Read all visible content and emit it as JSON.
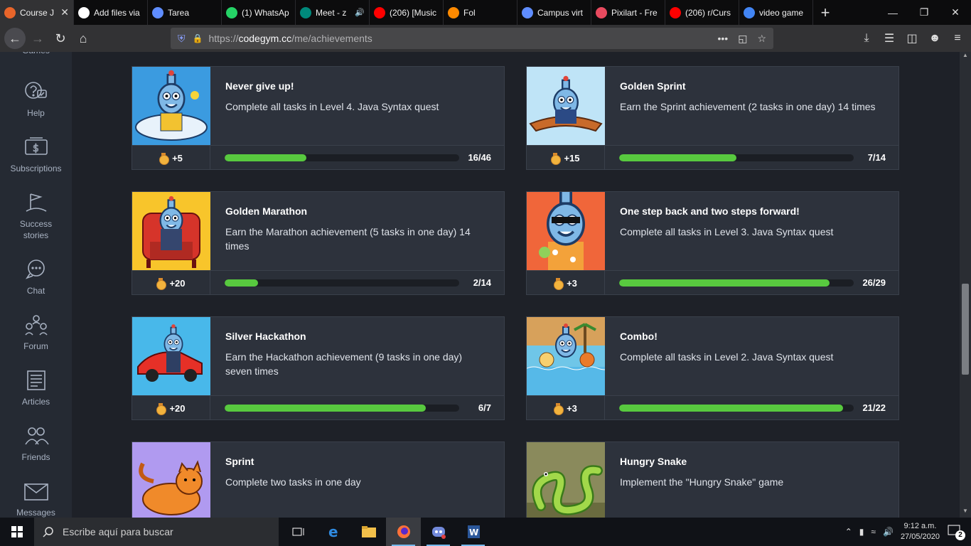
{
  "browser": {
    "tabs": [
      {
        "label": "Course J",
        "icon": "codegym-icon",
        "color": "#e8652a",
        "active": true
      },
      {
        "label": "Add files via",
        "icon": "github-icon",
        "color": "#ffffff"
      },
      {
        "label": "Tarea",
        "icon": "classroom-icon",
        "color": "#5f8dff"
      },
      {
        "label": "(1) WhatsAp",
        "icon": "whatsapp-icon",
        "color": "#25d366"
      },
      {
        "label": "Meet - z",
        "icon": "meet-icon",
        "color": "#00897b",
        "sound": true
      },
      {
        "label": "(206) [Music",
        "icon": "youtube-icon",
        "color": "#ff0000"
      },
      {
        "label": "Fol",
        "icon": "firefox-icon",
        "color": "#ff8a00"
      },
      {
        "label": "Campus virt",
        "icon": "campus-icon",
        "color": "#5f8dff"
      },
      {
        "label": "Pixilart - Fre",
        "icon": "pixilart-icon",
        "color": "#e84a5f"
      },
      {
        "label": "(206) r/Curs",
        "icon": "youtube-icon",
        "color": "#ff0000"
      },
      {
        "label": "video game",
        "icon": "google-icon",
        "color": "#4285f4"
      }
    ],
    "url": {
      "scheme": "https://",
      "host": "codegym.cc",
      "path": "/me/achievements"
    }
  },
  "sidebar": {
    "items": [
      {
        "label": "Games",
        "icon": "gamepad-icon"
      },
      {
        "label": "Help",
        "icon": "help-icon"
      },
      {
        "label": "Subscriptions",
        "icon": "subscriptions-icon"
      },
      {
        "label": "Success\nstories",
        "icon": "flag-icon"
      },
      {
        "label": "Chat",
        "icon": "chat-icon"
      },
      {
        "label": "Forum",
        "icon": "forum-icon"
      },
      {
        "label": "Articles",
        "icon": "articles-icon"
      },
      {
        "label": "Friends",
        "icon": "friends-icon"
      },
      {
        "label": "Messages",
        "icon": "messages-icon"
      }
    ]
  },
  "achievements": [
    {
      "title": "Never give up!",
      "description": "Complete all tasks in Level 4. Java Syntax quest",
      "reward": "+5",
      "progress_text": "16/46",
      "progress": 0.348,
      "image_bg": "#3b9be0",
      "image": "robot-in-bath"
    },
    {
      "title": "Golden Sprint",
      "description": "Earn the Sprint achievement (2 tasks in one day) 14 times",
      "reward": "+15",
      "progress_text": "7/14",
      "progress": 0.5,
      "image_bg": "#bfe4f7",
      "image": "robot-on-carpet"
    },
    {
      "title": "Golden Marathon",
      "description": "Earn the Marathon achievement (5 tasks in one day) 14 times",
      "reward": "+20",
      "progress_text": "2/14",
      "progress": 0.143,
      "image_bg": "#f8c52b",
      "image": "robot-in-armchair"
    },
    {
      "title": "One step back and two steps forward!",
      "description": "Complete all tasks in Level 3. Java Syntax quest",
      "reward": "+3",
      "progress_text": "26/29",
      "progress": 0.897,
      "image_bg": "#f0663a",
      "image": "robot-with-sunglasses"
    },
    {
      "title": "Silver Hackathon",
      "description": "Earn the Hackathon achievement (9 tasks in one day) seven times",
      "reward": "+20",
      "progress_text": "6/7",
      "progress": 0.857,
      "image_bg": "#48b8ea",
      "image": "robot-with-car"
    },
    {
      "title": "Combo!",
      "description": "Complete all tasks in Level 2. Java Syntax quest",
      "reward": "+3",
      "progress_text": "21/22",
      "progress": 0.955,
      "image_bg": "#6fc6e8",
      "image": "robot-in-pool"
    },
    {
      "title": "Sprint",
      "description": "Complete two tasks in one day",
      "reward": "",
      "progress_text": "",
      "progress": null,
      "image_bg": "#b09af0",
      "image": "orange-cat"
    },
    {
      "title": "Hungry Snake",
      "description": "Implement the \"Hungry Snake\" game",
      "reward": "",
      "progress_text": "",
      "progress": null,
      "image_bg": "#8a8a5c",
      "image": "green-snake"
    }
  ],
  "taskbar": {
    "search_placeholder": "Escribe aquí para buscar",
    "time": "9:12 a.m.",
    "date": "27/05/2020",
    "notifications": "2"
  }
}
